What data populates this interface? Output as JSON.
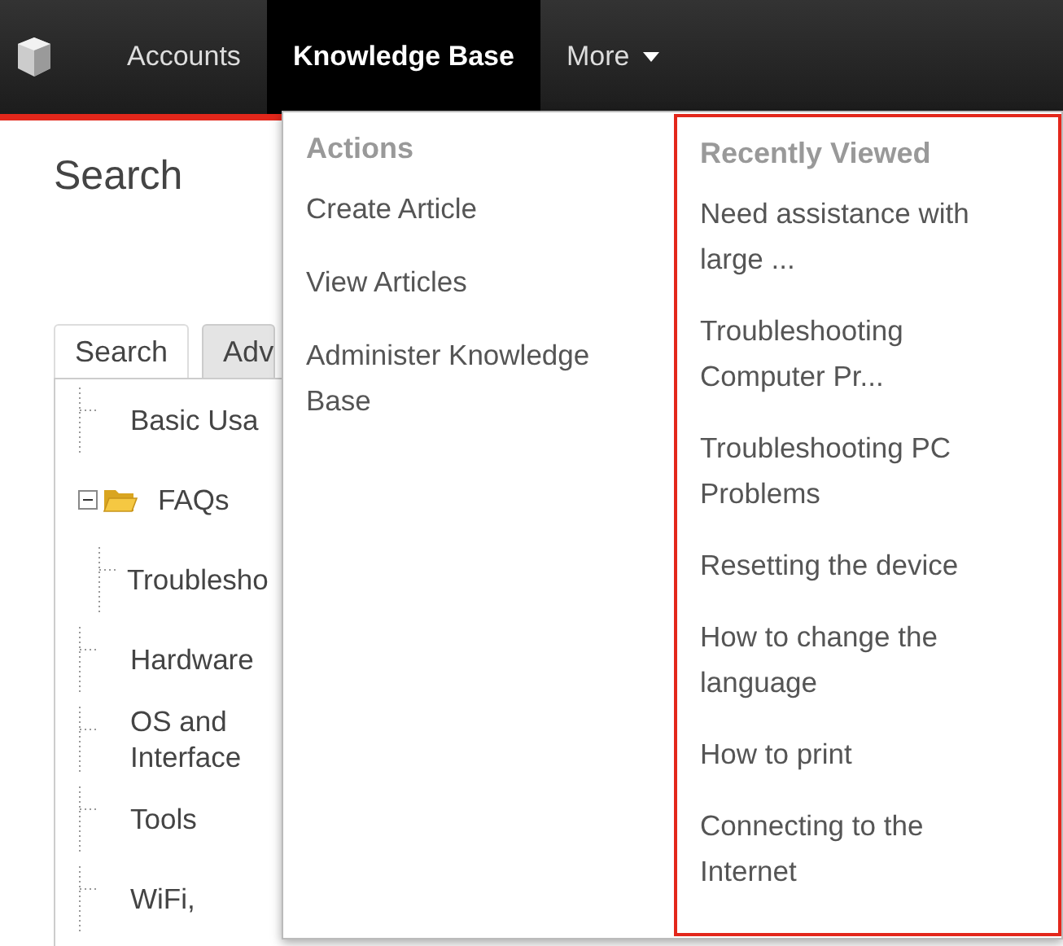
{
  "nav": {
    "items": [
      {
        "label": "Accounts",
        "selected": false
      },
      {
        "label": "Knowledge Base",
        "selected": true
      },
      {
        "label": "More",
        "selected": false,
        "kind": "dropdown"
      }
    ]
  },
  "page": {
    "title": "Search",
    "tabs": [
      {
        "label": "Search",
        "selected": true
      },
      {
        "label": "Adv",
        "selected": false
      }
    ],
    "tree": [
      {
        "label": "Basic Usa"
      },
      {
        "label": "FAQs",
        "expanded": true,
        "children": [
          {
            "label": "Troublesho"
          }
        ]
      },
      {
        "label": "Hardware"
      },
      {
        "label": "OS and Interface"
      },
      {
        "label": "Tools"
      },
      {
        "label": "WiFi,"
      }
    ]
  },
  "menu": {
    "actions": {
      "heading": "Actions",
      "items": [
        "Create Article",
        "View Articles",
        "Administer Knowledge Base"
      ]
    },
    "recently_viewed": {
      "heading": "Recently Viewed",
      "highlighted": true,
      "items": [
        "Need assistance with large ...",
        "Troubleshooting Computer Pr...",
        "Troubleshooting PC Problems",
        "Resetting the device",
        "How to change the language",
        "How to print",
        "Connecting to the Internet"
      ]
    }
  }
}
